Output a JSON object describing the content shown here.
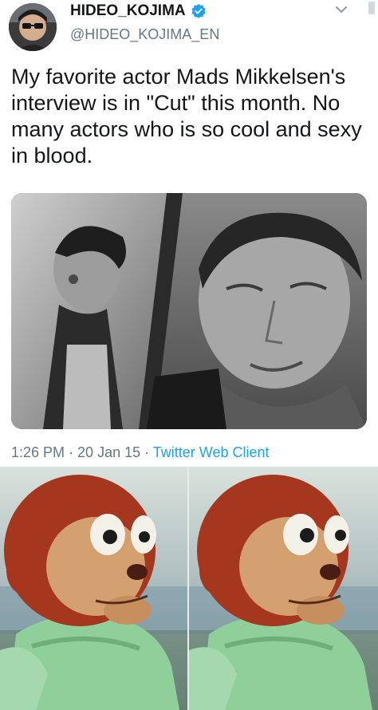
{
  "tweet": {
    "display_name": "HIDEO_KOJIMA",
    "handle": "@HIDEO_KOJIMA_EN",
    "text": "My favorite actor Mads Mikkelsen's interview is in \"Cut\" this month. No many actors who is so cool and sexy in blood.",
    "meta": {
      "time": "1:26 PM",
      "date": "20 Jan 15",
      "separator": " · ",
      "client": "Twitter Web Client"
    },
    "icons": {
      "verified": "verified-badge-icon",
      "menu": "chevron-down-icon"
    },
    "colors": {
      "verified": "#1da1f2",
      "link": "#1da1f2",
      "secondary_text": "#657786",
      "primary_text": "#14171a"
    }
  },
  "meme": {
    "panels": [
      {
        "label": ""
      },
      {
        "label": ""
      }
    ]
  }
}
